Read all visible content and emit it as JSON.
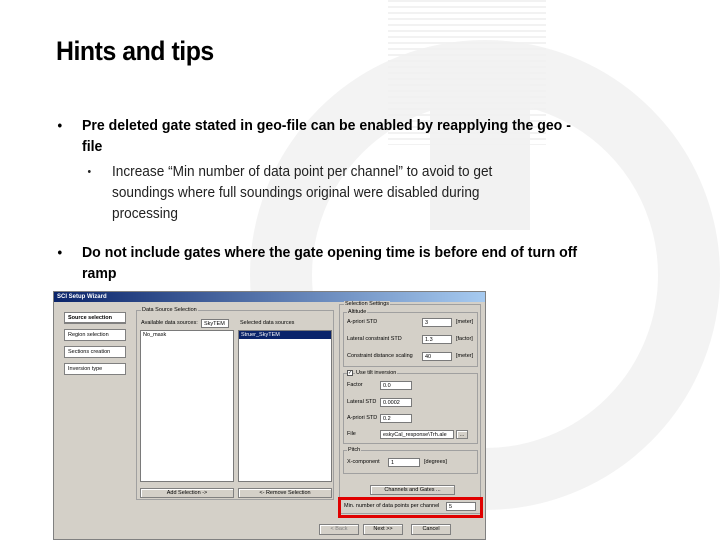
{
  "slide": {
    "title": "Hints and tips",
    "bullets": [
      {
        "text": "Pre deleted gate stated in geo-file can be enabled by reapplying the geo -file",
        "marker": "•"
      },
      {
        "text": "Increase “Min number of data point per channel” to avoid to get soundings where full soundings original were disabled during processing",
        "marker": "•"
      },
      {
        "text": "Do not include gates where the gate opening time is before end of turn off ramp",
        "marker": "•"
      }
    ]
  },
  "wizard": {
    "title": "SCI Setup Wizard",
    "steps": [
      {
        "label": "Source selection",
        "active": true
      },
      {
        "label": "Region selection",
        "active": false
      },
      {
        "label": "Sections creation",
        "active": false
      },
      {
        "label": "Inversion type",
        "active": false
      }
    ],
    "data_source": {
      "group_label": "Data Source Selection",
      "available_label": "Available data sources:",
      "available_type": "SkyTEM",
      "available_items": [
        "No_mask"
      ],
      "selected_label": "Selected data sources",
      "selected_items": [
        "Struer_SkyTEM"
      ],
      "add_button": "Add Selection ->",
      "remove_button": "<- Remove Selection"
    },
    "selection_settings": {
      "group_label": "Selection Settings",
      "altitude": {
        "label": "Altitude",
        "rows": [
          {
            "label": "A-priori STD",
            "value": "3",
            "unit": "[meter]"
          },
          {
            "label": "Lateral constraint STD",
            "value": "1.3",
            "unit": "[factor]"
          },
          {
            "label": "Constraint distance scaling",
            "value": "40",
            "unit": "[meter]"
          }
        ]
      },
      "tilt": {
        "label": "Use tilt inversion",
        "checked": "✓",
        "rows": [
          {
            "label": "Factor",
            "value": "0.0"
          },
          {
            "label": "Lateral STD",
            "value": "0.0002"
          },
          {
            "label": "A-priori STD",
            "value": "0.2"
          }
        ],
        "file_label": "File",
        "file_value": "eskyCal_response\\Trh.ale",
        "browse": "..."
      },
      "pitch": {
        "label": "Pitch",
        "row_label": "X-component",
        "value": "1",
        "unit": "[degrees]"
      },
      "channels_button": "Channels and Gates ...",
      "min_points_label": "Min. number of data points per channel",
      "min_points_value": "5"
    },
    "nav": {
      "back": "< Back",
      "next": "Next >>",
      "cancel": "Cancel"
    }
  }
}
